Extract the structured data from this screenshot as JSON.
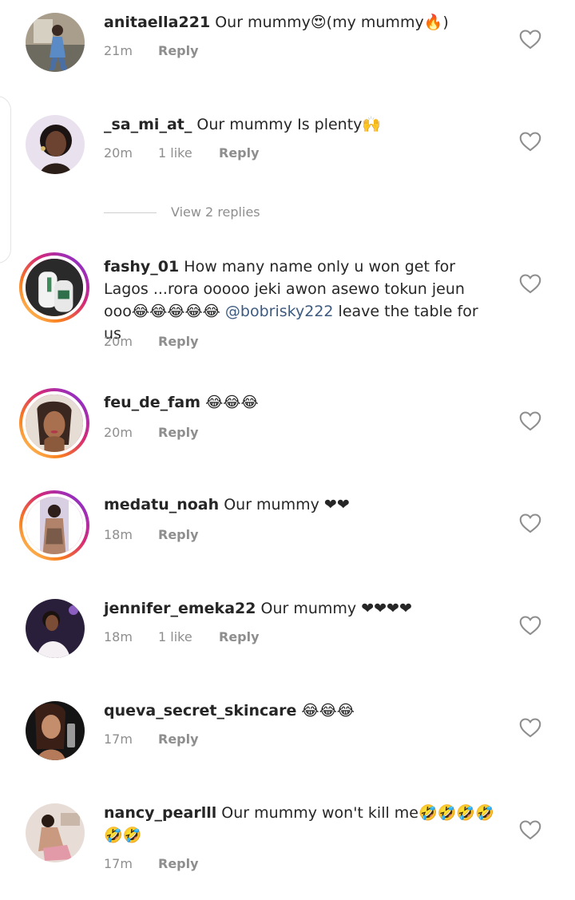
{
  "reply_label": "Reply",
  "view_replies_label": "View 2 replies",
  "comments": [
    {
      "username": "anitaella221",
      "text": " Our mummy😍(my mummy🔥)",
      "time": "21m",
      "likes": ""
    },
    {
      "username": "_sa_mi_at_",
      "text": " Our mummy Is plenty🙌",
      "time": "20m",
      "likes": "1 like"
    },
    {
      "username": "fashy_01",
      "text": " How many name only u won get for Lagos ...rora ooooo jeki awon asewo tokun jeun ooo😂😂😂😂😂 ",
      "mention": "@bobrisky222",
      "text_after": "  leave the table for us",
      "time": "20m",
      "likes": ""
    },
    {
      "username": "feu_de_fam",
      "text": " 😂😂😂",
      "time": "20m",
      "likes": ""
    },
    {
      "username": "medatu_noah",
      "text": " Our mummy ❤❤",
      "time": "18m",
      "likes": ""
    },
    {
      "username": "jennifer_emeka22",
      "text": " Our mummy ❤❤❤❤",
      "time": "18m",
      "likes": "1 like"
    },
    {
      "username": "queva_secret_skincare",
      "text": " 😂😂😂",
      "time": "17m",
      "likes": ""
    },
    {
      "username": "nancy_pearlll",
      "text": " Our mummy won't kill me🤣🤣🤣🤣🤣🤣",
      "time": "17m",
      "likes": ""
    }
  ]
}
